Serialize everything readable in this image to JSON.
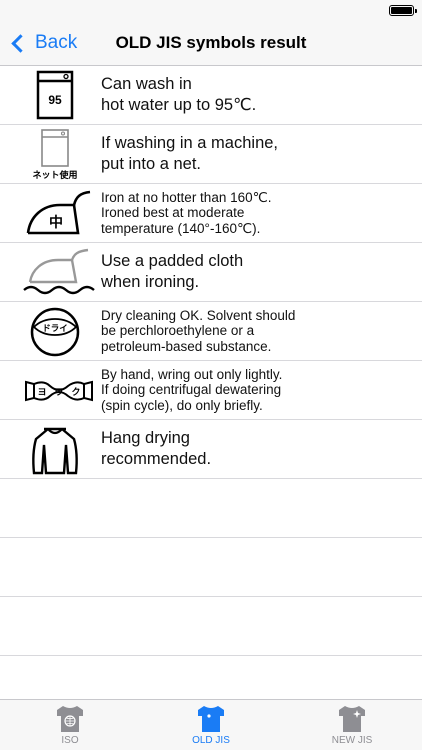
{
  "nav": {
    "back_label": "Back",
    "title": "OLD JIS symbols result"
  },
  "rows": [
    {
      "icon": "wash-95-icon",
      "icon_text": "95",
      "text": "Can wash in\nhot water up to 95℃."
    },
    {
      "icon": "machine-net-icon",
      "icon_text": "ネット使用",
      "text": "If washing in a machine,\nput into a net."
    },
    {
      "icon": "iron-medium-icon",
      "icon_text": "中",
      "text": "Iron at no hotter than 160℃.\nIroned best at moderate\ntemperature (140°-160℃)."
    },
    {
      "icon": "iron-padded-cloth-icon",
      "text": "Use a padded cloth\nwhen ironing."
    },
    {
      "icon": "dry-clean-icon",
      "icon_text": "ドライ",
      "text": "Dry cleaning OK. Solvent should\nbe perchloroethylene or a\npetroleum-based substance."
    },
    {
      "icon": "wring-lightly-icon",
      "icon_text": [
        "ヨ",
        "ワ",
        "ク"
      ],
      "text": "By hand, wring out only lightly.\nIf doing centrifugal dewatering\n (spin cycle), do only briefly."
    },
    {
      "icon": "hang-dry-icon",
      "text": "Hang drying\nrecommended."
    }
  ],
  "tabs": [
    {
      "label": "ISO",
      "icon": "iso-shirt-icon",
      "active": false
    },
    {
      "label": "OLD JIS",
      "icon": "old-jis-shirt-icon",
      "active": true
    },
    {
      "label": "NEW JIS",
      "icon": "new-jis-shirt-icon",
      "active": false
    }
  ],
  "colors": {
    "accent": "#1a7cf5",
    "inactive": "#8e8e93",
    "separator": "#d8d8dc"
  }
}
